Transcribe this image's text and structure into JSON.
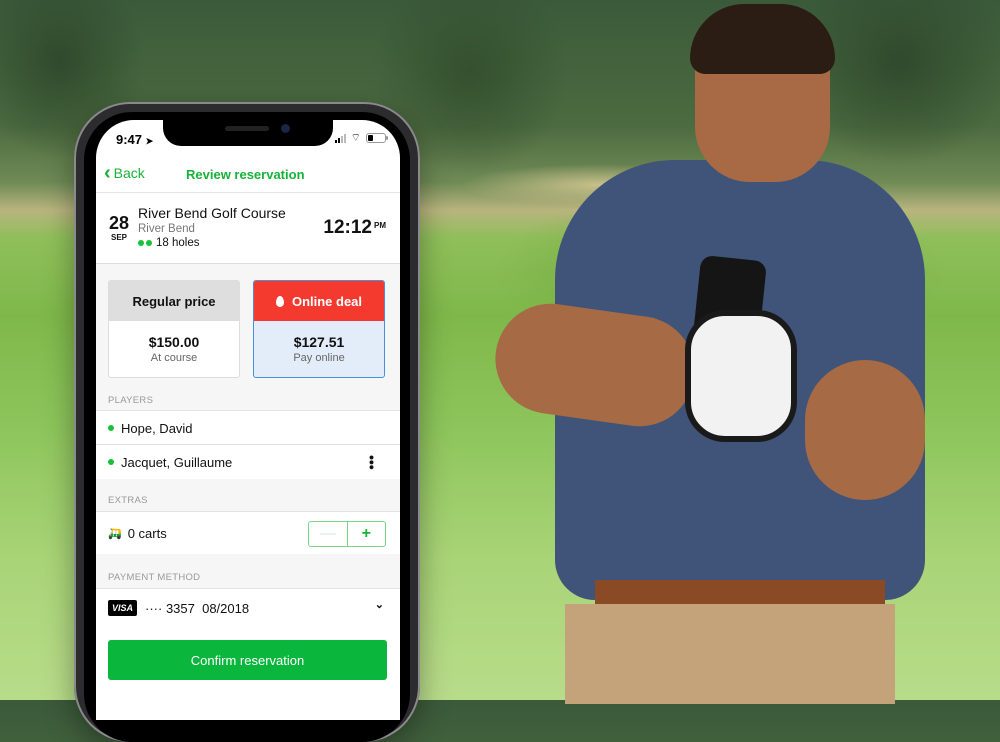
{
  "status_bar": {
    "time": "9:47",
    "location_icon": "location-arrow-icon",
    "icons": [
      "signal-icon",
      "wifi-icon",
      "battery-icon"
    ]
  },
  "nav": {
    "back_label": "Back",
    "title": "Review reservation"
  },
  "booking": {
    "day": "28",
    "month": "SEP",
    "course_name": "River Bend Golf Course",
    "area": "River Bend",
    "holes": "18 holes",
    "time": "12:12",
    "ampm": "PM"
  },
  "prices": {
    "regular": {
      "title": "Regular price",
      "amount": "$150.00",
      "subtitle": "At course"
    },
    "deal": {
      "title": "Online deal",
      "amount": "$127.51",
      "subtitle": "Pay online",
      "selected": true
    }
  },
  "players": {
    "label": "PLAYERS",
    "items": [
      "Hope, David",
      "Jacquet, Guillaume"
    ]
  },
  "extras": {
    "label": "EXTRAS",
    "carts_label": "0 carts",
    "minus": "—",
    "plus": "+"
  },
  "payment": {
    "label": "PAYMENT METHOD",
    "card_brand": "VISA",
    "card_masked": "···· 3357  08/2018"
  },
  "confirm_label": "Confirm reservation",
  "colors": {
    "accent_green": "#17b23a",
    "deal_red": "#f43a2f",
    "deal_bg": "#e3edfa",
    "confirm_green": "#0ab73c"
  }
}
